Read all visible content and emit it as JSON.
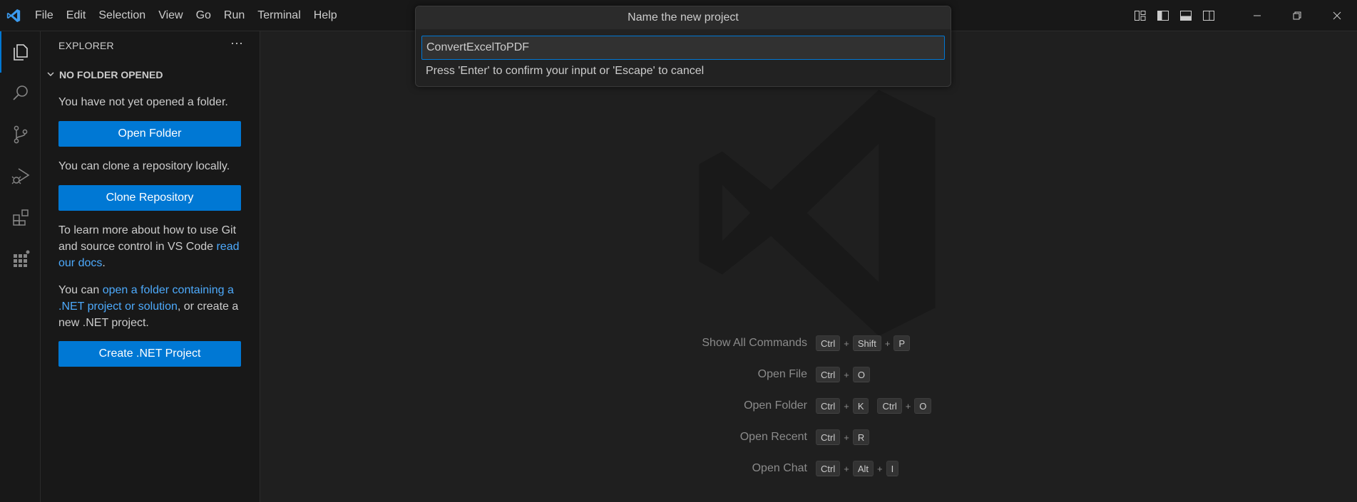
{
  "menu": [
    "File",
    "Edit",
    "Selection",
    "View",
    "Go",
    "Run",
    "Terminal",
    "Help"
  ],
  "quick_input": {
    "title": "Name the new project",
    "value": "ConvertExcelToPDF",
    "message": "Press 'Enter' to confirm your input or 'Escape' to cancel"
  },
  "sidebar": {
    "title": "EXPLORER",
    "more": "···",
    "section": "NO FOLDER OPENED",
    "text1": "You have not yet opened a folder.",
    "open_folder": "Open Folder",
    "text2": "You can clone a repository locally.",
    "clone_repo": "Clone Repository",
    "git_text": "To learn more about how to use Git and source control in VS Code",
    "git_link": "read our docs",
    "git_tail": ".",
    "dotnet_pre": "You can",
    "dotnet_link": "open a folder containing a .NET project or solution",
    "dotnet_tail": ", or create a new .NET project.",
    "create_dotnet": "Create .NET Project"
  },
  "activity_icons": [
    "explorer-icon",
    "search-icon",
    "source-control-icon",
    "run-debug-icon",
    "extensions-icon",
    "dotnet-solution-icon"
  ],
  "shortcuts": [
    {
      "label": "Show All Commands",
      "keys": [
        [
          "Ctrl",
          "Shift",
          "P"
        ]
      ]
    },
    {
      "label": "Open File",
      "keys": [
        [
          "Ctrl",
          "O"
        ]
      ]
    },
    {
      "label": "Open Folder",
      "keys": [
        [
          "Ctrl",
          "K"
        ],
        [
          "Ctrl",
          "O"
        ]
      ]
    },
    {
      "label": "Open Recent",
      "keys": [
        [
          "Ctrl",
          "R"
        ]
      ]
    },
    {
      "label": "Open Chat",
      "keys": [
        [
          "Ctrl",
          "Alt",
          "I"
        ]
      ]
    }
  ],
  "colors": {
    "accent": "#0078d4",
    "link": "#4daafc",
    "background": "#1f1f1f",
    "sidebar": "#181818"
  }
}
